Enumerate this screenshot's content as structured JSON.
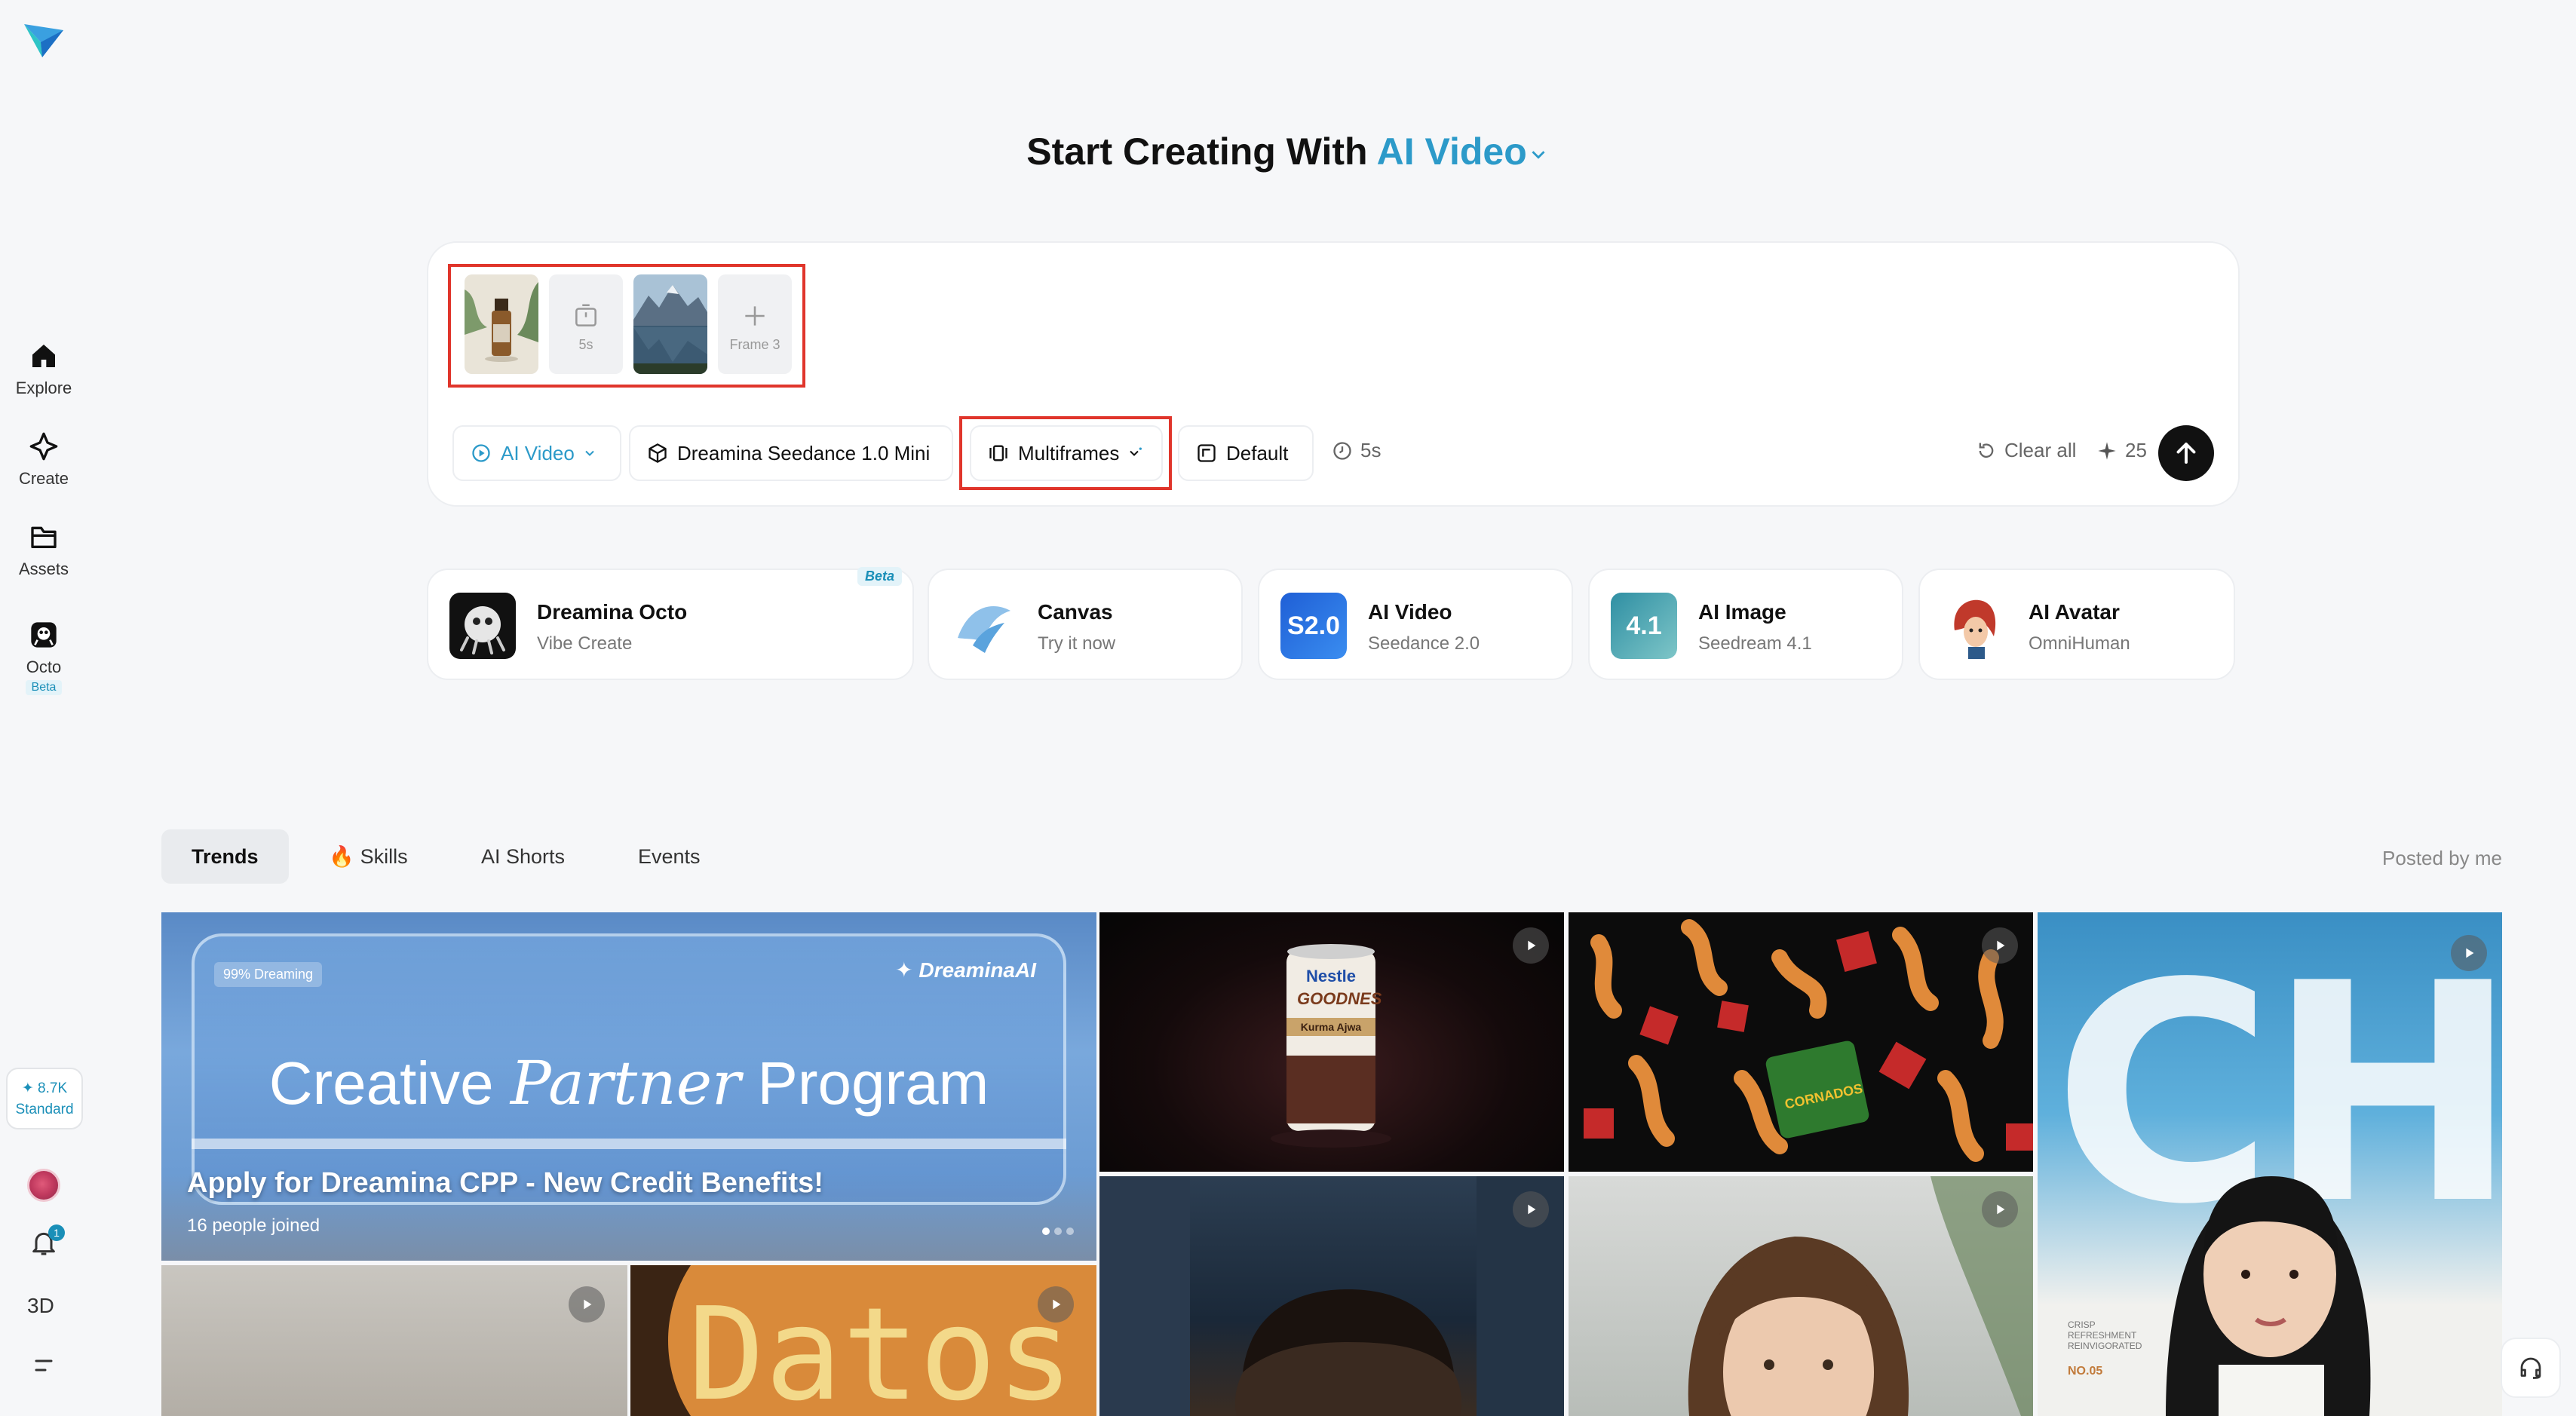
{
  "headline": {
    "prefix": "Start Creating With",
    "mode": "AI Video"
  },
  "sidebar": {
    "items": [
      {
        "label": "Explore"
      },
      {
        "label": "Create"
      },
      {
        "label": "Assets"
      },
      {
        "label": "Octo",
        "badge": "Beta"
      }
    ],
    "credits": {
      "amount": "8.7K",
      "plan": "Standard"
    },
    "notifications_count": "1",
    "three_d_label": "3D"
  },
  "prompt": {
    "frames": [
      {
        "type": "image",
        "name": "serum bottle"
      },
      {
        "type": "duration",
        "label": "5s"
      },
      {
        "type": "image",
        "name": "mountain lake"
      },
      {
        "type": "add",
        "label": "Frame 3"
      }
    ],
    "toolbar": {
      "mode": "AI Video",
      "model": "Dreamina Seedance 1.0 Mini",
      "frames_mode": "Multiframes",
      "ratio": "Default",
      "duration": "5s",
      "clear": "Clear all",
      "cost": "25"
    }
  },
  "cards": [
    {
      "title": "Dreamina Octo",
      "subtitle": "Vibe Create",
      "badge": "Beta"
    },
    {
      "title": "Canvas",
      "subtitle": "Try it now"
    },
    {
      "title": "AI Video",
      "subtitle": "Seedance 2.0",
      "icon_text": "S2.0"
    },
    {
      "title": "AI Image",
      "subtitle": "Seedream 4.1",
      "icon_text": "4.1"
    },
    {
      "title": "AI Avatar",
      "subtitle": "OmniHuman"
    }
  ],
  "tabs": [
    "Trends",
    "Skills",
    "AI Shorts",
    "Events"
  ],
  "posted_by_me": "Posted by me",
  "feed": {
    "banner": {
      "tag": "99% Dreaming",
      "brand": "DreaminaAI",
      "program": "Creative Partner Program",
      "program_parts": [
        "Creative",
        "Partner",
        "Program"
      ],
      "title": "Apply for Dreamina CPP - New Credit Benefits!",
      "joined": "16 people joined"
    },
    "nestle": {
      "brand": "Nestle",
      "product": "GOODNES",
      "flavor": "Kurma Ajwa"
    },
    "snack": {
      "label": "CORNADOS"
    },
    "chill": {
      "word": "CHILL",
      "small": "CRISP REFRESHMENT REINVIGORATED",
      "issue": "NO.05"
    },
    "datos": {
      "word": "Datos"
    }
  },
  "colors": {
    "accent": "#2c9ac9",
    "highlight": "#e0352b"
  }
}
